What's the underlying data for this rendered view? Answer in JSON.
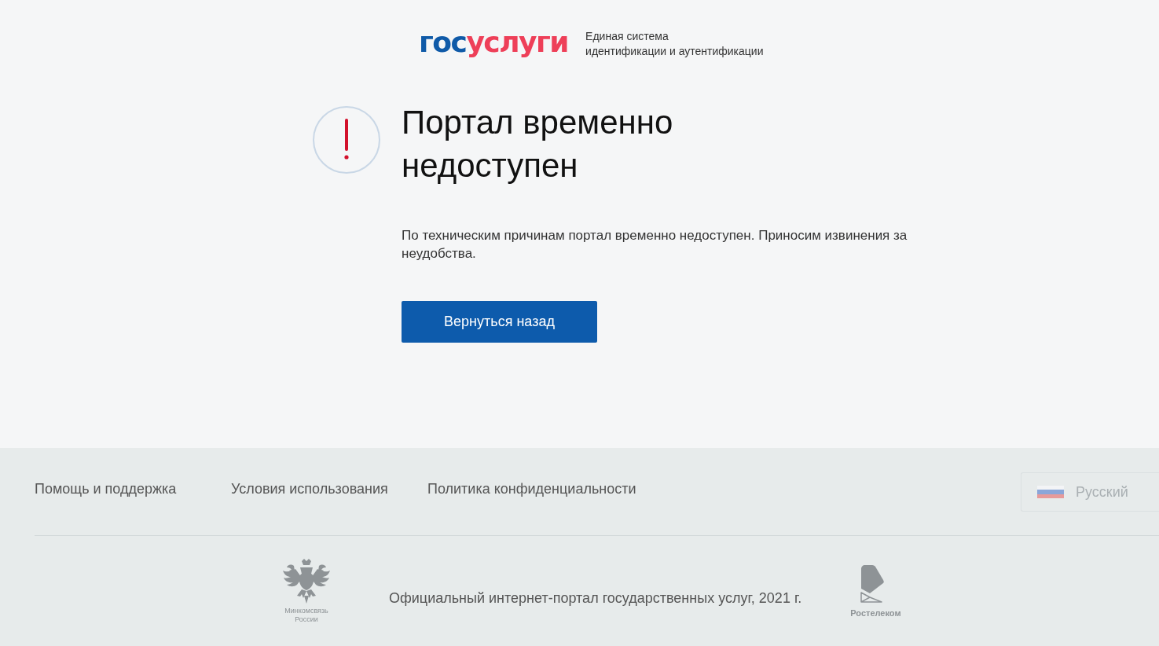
{
  "header": {
    "logo": {
      "part_1": "гос",
      "part_2": "услуги"
    },
    "caption": "Единая система\nидентификации и аутентификации"
  },
  "message": {
    "title": "Портал временно недоступен",
    "text": "По техническим причинам портал временно недоступен. Приносим извинения за неудобства.",
    "button": "Вернуться назад"
  },
  "footer": {
    "links": [
      "Помощь и поддержка",
      "Условия использования",
      "Политика конфиденциальности"
    ],
    "language": {
      "label": "Русский"
    },
    "emblem_caption": "Минкомсвязь\nРоссии",
    "copyright": "Официальный интернет-портал государственных услуг, 2021 г.",
    "operator_caption": "Ростелеком"
  }
}
